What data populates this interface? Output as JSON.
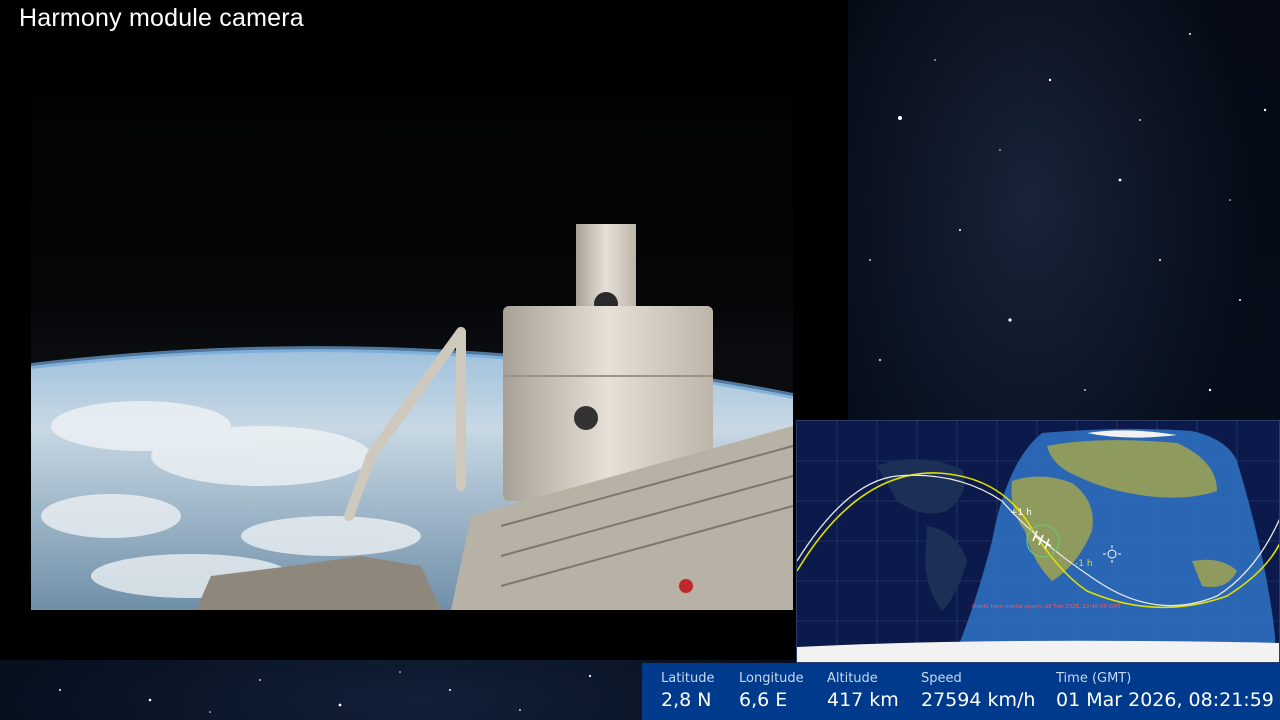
{
  "feed": {
    "title": "Harmony module camera"
  },
  "map": {
    "footnote": "Orbits from orbital epoch: 28 Feb 2026, 22:46:09 GMT",
    "orbit_mark_1": "+1 h",
    "orbit_mark_2": "-1 h",
    "colors": {
      "night_ocean": "#0b1a4a",
      "day_ocean": "#2d6fbf",
      "orbit_current": "#e0e000",
      "orbit_next": "#e8e8e8"
    }
  },
  "telemetry": {
    "latitude": {
      "label": "Latitude",
      "value": "2,8 N"
    },
    "longitude": {
      "label": "Longitude",
      "value": "6,6 E"
    },
    "altitude": {
      "label": "Altitude",
      "value": "417 km"
    },
    "speed": {
      "label": "Speed",
      "value": "27594 km/h"
    },
    "time": {
      "label": "Time (GMT)",
      "value": "01 Mar 2026, 08:21:59"
    }
  }
}
